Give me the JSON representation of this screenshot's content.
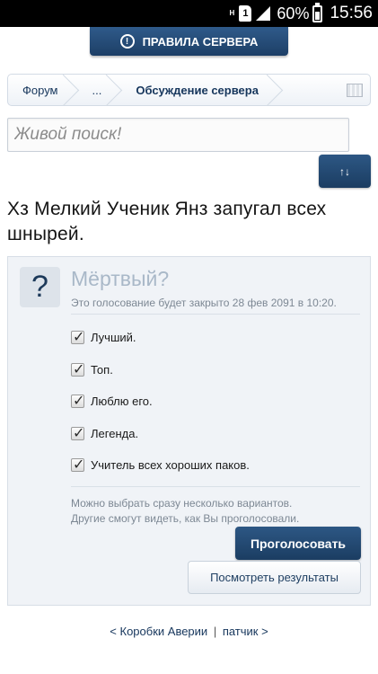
{
  "status_bar": {
    "network": "H",
    "sim": "1",
    "battery": "60%",
    "time": "15:56"
  },
  "header": {
    "rules_button": "ПРАВИЛА СЕРВЕРА",
    "rules_icon": "!"
  },
  "breadcrumb": {
    "items": [
      "Форум",
      "...",
      "Обсуждение сервера"
    ],
    "menu_icon": "list-icon"
  },
  "search": {
    "placeholder": "Живой поиск!"
  },
  "toolbar": {
    "sort_label": "↑↓"
  },
  "thread": {
    "title": "Хз Мелкий Ученик Янз запугал всех шнырей."
  },
  "poll": {
    "icon": "?",
    "question": "Мёртвый?",
    "closing_note": "Это голосование будет закрыто 28 фев 2091 в 10:20.",
    "options": [
      {
        "label": "Лучший.",
        "checked": true
      },
      {
        "label": "Топ.",
        "checked": true
      },
      {
        "label": "Люблю его.",
        "checked": true
      },
      {
        "label": "Легенда.",
        "checked": true
      },
      {
        "label": "Учитель всех хороших паков.",
        "checked": true
      }
    ],
    "note_line1": "Можно выбрать сразу несколько вариантов.",
    "note_line2": "Другие смогут видеть, как Вы проголосовали.",
    "vote_button": "Проголосовать",
    "results_button": "Посмотреть результаты"
  },
  "footer": {
    "prev": "< Коробки Аверии",
    "separator": "|",
    "next": "патчик >"
  }
}
